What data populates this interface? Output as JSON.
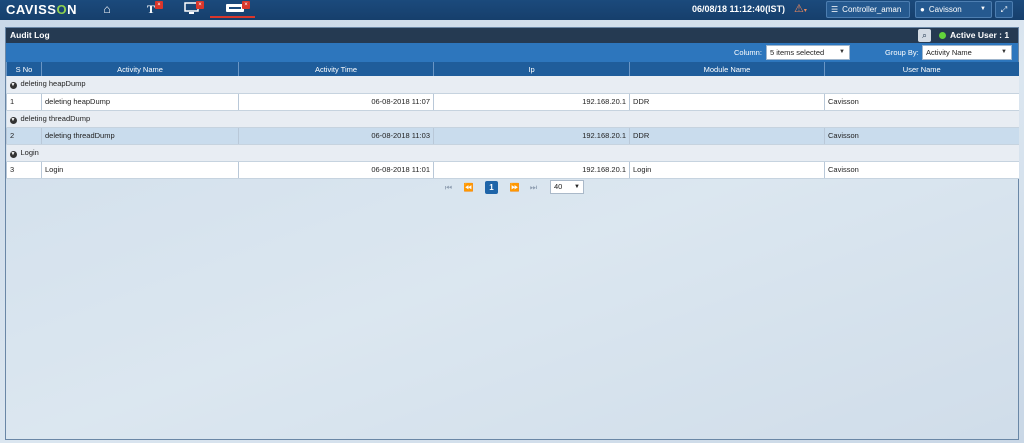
{
  "app": {
    "logo_left": "CAVISS",
    "logo_dot": "O",
    "logo_right": "N"
  },
  "topbar": {
    "datetime": "06/08/18 11:12:40(IST)",
    "controller_label": "Controller_aman",
    "user_label": "Cavisson",
    "badge_mark": "×"
  },
  "panel": {
    "title": "Audit Log",
    "active_user": "Active User : 1",
    "column_label": "Column:",
    "column_value": "5 items selected",
    "groupby_label": "Group By:",
    "groupby_value": "Activity Name"
  },
  "table": {
    "headers": [
      "S No",
      "Activity Name",
      "Activity Time",
      "Ip",
      "Module Name",
      "User Name"
    ],
    "groups": [
      {
        "name": "deleting heapDump",
        "row": {
          "sno": "1",
          "activity": "deleting heapDump",
          "time": "06-08-2018 11:07",
          "ip": "192.168.20.1",
          "module": "DDR",
          "user": "Cavisson"
        }
      },
      {
        "name": "deleting threadDump",
        "row": {
          "sno": "2",
          "activity": "deleting threadDump",
          "time": "06-08-2018 11:03",
          "ip": "192.168.20.1",
          "module": "DDR",
          "user": "Cavisson"
        }
      },
      {
        "name": "Login",
        "row": {
          "sno": "3",
          "activity": "Login",
          "time": "06-08-2018 11:01",
          "ip": "192.168.20.1",
          "module": "Login",
          "user": "Cavisson"
        }
      }
    ]
  },
  "pager": {
    "current_page": "1",
    "page_size": "40"
  },
  "colors": {
    "topbar": "#1b4a7c",
    "header_blue": "#2d76bd",
    "panel_dark": "#253a52",
    "accent_red": "#d9362b",
    "online_green": "#62d33b"
  }
}
